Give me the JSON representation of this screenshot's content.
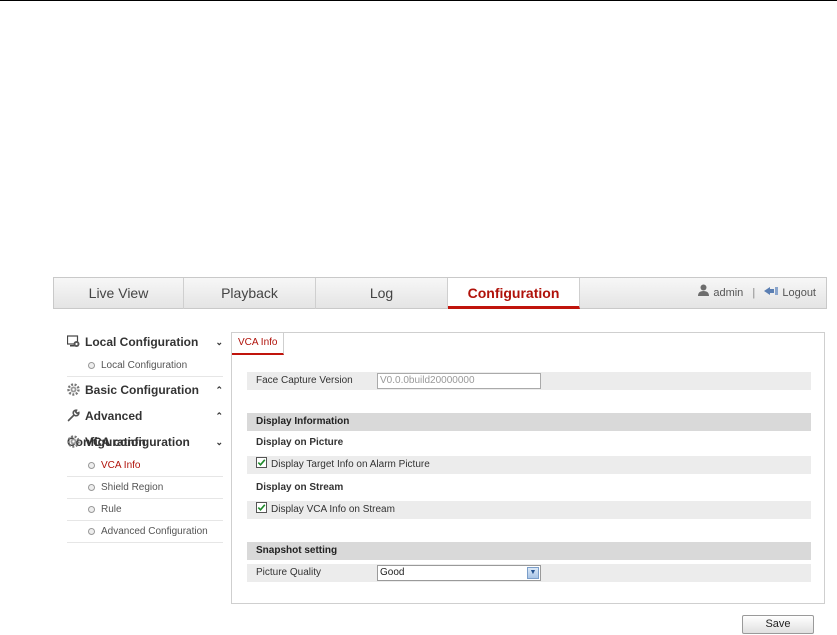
{
  "nav": {
    "tabs": [
      {
        "label": "Live View"
      },
      {
        "label": "Playback"
      },
      {
        "label": "Log"
      },
      {
        "label": "Configuration",
        "active": true
      }
    ],
    "user": "admin",
    "separator": "|",
    "logout": "Logout"
  },
  "sidebar": {
    "groups": [
      {
        "label": "Local Configuration",
        "icon": "monitor-gear-icon",
        "state": "expanded",
        "items": [
          "Local Configuration"
        ]
      },
      {
        "label": "Basic Configuration",
        "icon": "gear-icon",
        "state": "collapsed"
      },
      {
        "label": "Advanced Configuration",
        "icon": "wrench-icon",
        "state": "collapsed"
      },
      {
        "label": "VCA configuration",
        "icon": "gear-icon",
        "state": "expanded",
        "items": [
          "VCA Info",
          "Shield Region",
          "Rule",
          "Advanced Configuration"
        ],
        "active_item": "VCA Info"
      }
    ]
  },
  "content": {
    "tab": "VCA Info",
    "face_capture_label": "Face Capture Version",
    "face_capture_value": "V0.0.0build20000000",
    "display_info_title": "Display Information",
    "display_on_picture_label": "Display on Picture",
    "target_info_label": "Display Target Info on Alarm Picture",
    "target_info_checked": true,
    "display_on_stream_label": "Display on Stream",
    "vca_stream_label": "Display VCA Info on Stream",
    "vca_stream_checked": true,
    "snapshot_title": "Snapshot setting",
    "picture_quality_label": "Picture Quality",
    "picture_quality_value": "Good",
    "save_label": "Save"
  },
  "colors": {
    "accent": "#b0120a",
    "section_bg": "#d9d9d9",
    "row_bg": "#ececec"
  }
}
